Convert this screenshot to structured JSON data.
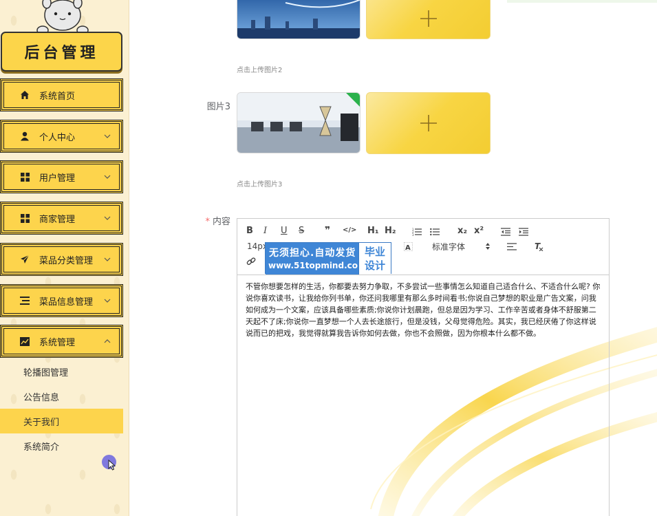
{
  "sidebar": {
    "title": "后台管理",
    "items": [
      {
        "label": "系统首页",
        "icon": "home-icon"
      },
      {
        "label": "个人中心",
        "icon": "user-icon",
        "expandable": true
      },
      {
        "label": "用户管理",
        "icon": "grid-icon",
        "expandable": true
      },
      {
        "label": "商家管理",
        "icon": "grid-icon",
        "expandable": true
      },
      {
        "label": "菜品分类管理",
        "icon": "send-icon",
        "expandable": true
      },
      {
        "label": "菜品信息管理",
        "icon": "list-icon",
        "expandable": true
      },
      {
        "label": "系统管理",
        "icon": "chart-icon",
        "expanded": true
      }
    ],
    "submenu": [
      {
        "label": "轮播图管理",
        "active": false
      },
      {
        "label": "公告信息",
        "active": false
      },
      {
        "label": "关于我们",
        "active": true
      },
      {
        "label": "系统简介",
        "active": false
      }
    ]
  },
  "form": {
    "hint2": "点击上传图片2",
    "image3_label": "图片3",
    "hint3": "点击上传图片3",
    "content_required": "*",
    "content_label": "内容"
  },
  "editor": {
    "toolbar": {
      "bold": "B",
      "italic": "I",
      "underline": "U",
      "strike": "S",
      "quote": "❞",
      "code": "</>",
      "h1": "H₁",
      "h2": "H₂",
      "subscript": "x₂",
      "superscript": "x²",
      "font_size": "14px",
      "font_family": "标准字体"
    },
    "watermark": {
      "line1": "无须担心.自动发货",
      "line2": "www.51topmind.com",
      "side1": "毕业",
      "side2": "设计"
    },
    "content": "不管你想要怎样的生活，你都要去努力争取，不多尝试一些事情怎么知道自己适合什么、不适合什么呢? 你说你喜欢读书，让我给你列书单，你还问我哪里有那么多时间看书;你说自己梦想的职业是广告文案，问我如何成为一个文案，应该具备哪些素质;你说你计划晨跑，但总是因为学习、工作辛苦或者身体不舒服第二天起不了床;你说你一直梦想一个人去长途旅行，但是没钱，父母觉得危险。其实，我已经厌倦了你这样说说而已的把戏，我觉得就算我告诉你如何去做，你也不会照做，因为你根本什么都不做。"
  },
  "colors": {
    "accent": "#fdd44c",
    "sidebar_bg": "#fbf0d2",
    "required": "#f56c6c",
    "watermark_blue": "#3f86d6"
  }
}
